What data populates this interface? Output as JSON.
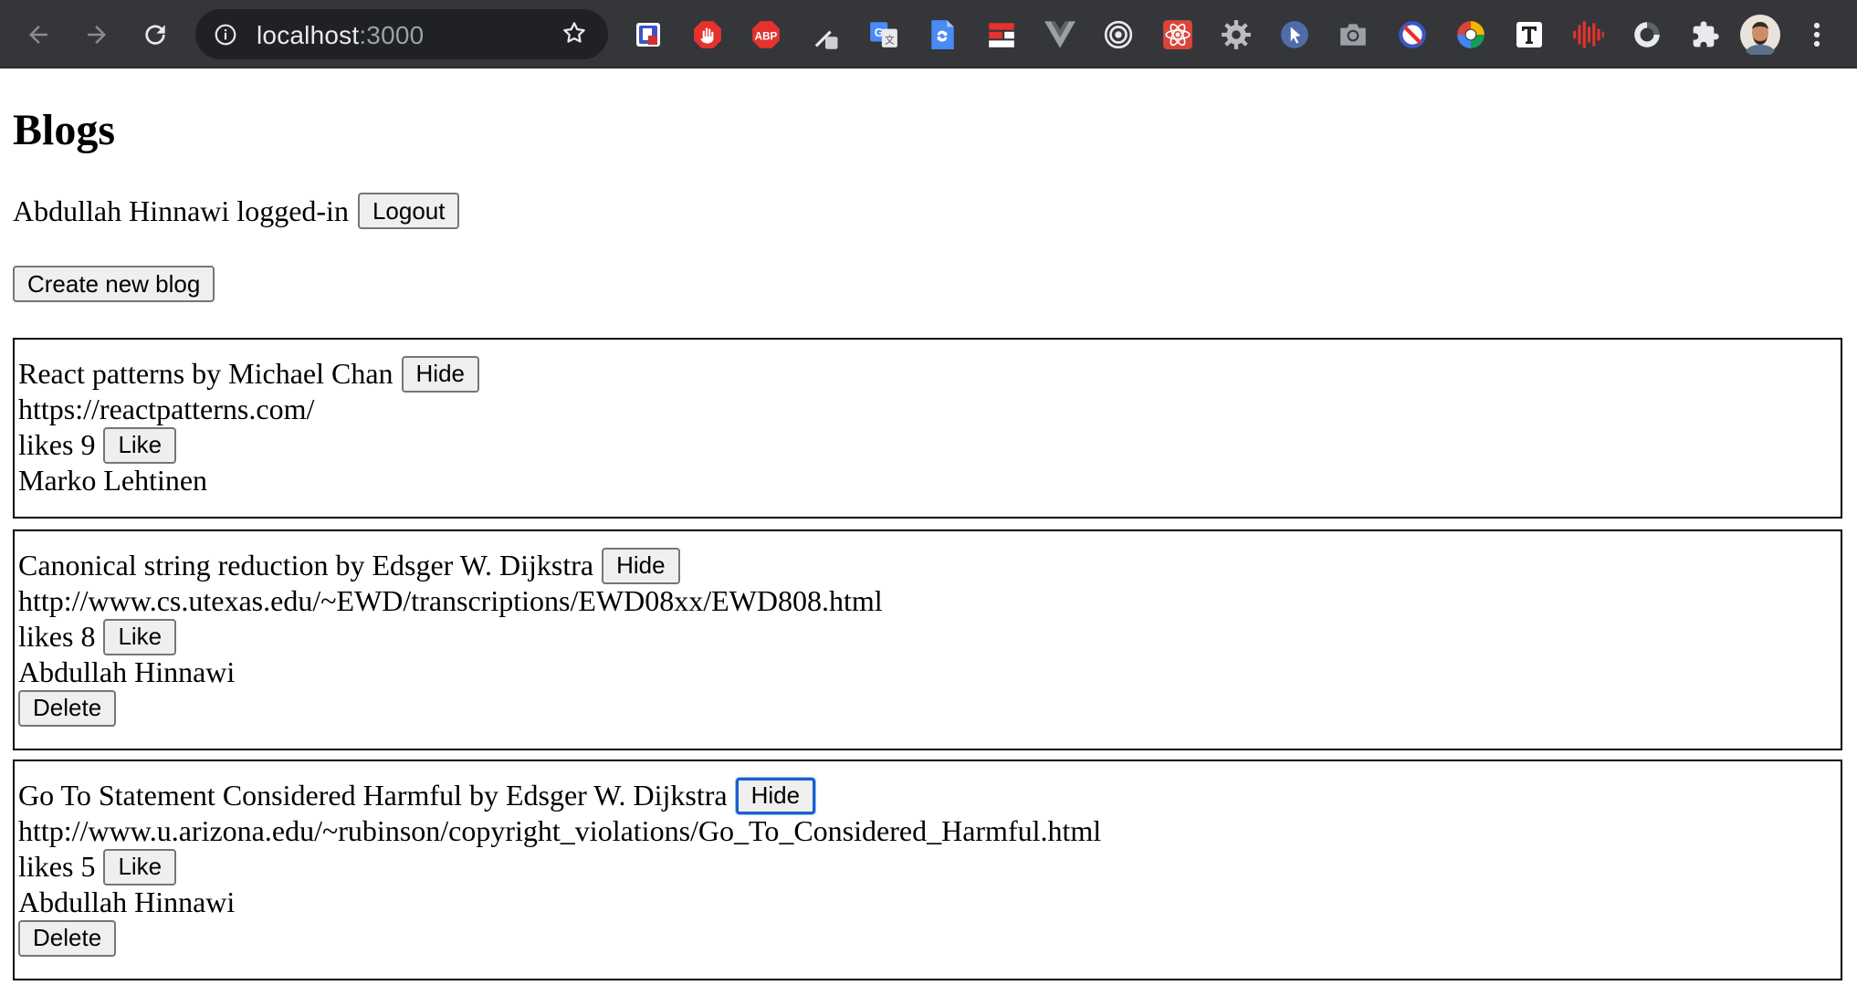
{
  "browser": {
    "url_host": "localhost",
    "url_port": ":3000",
    "extensions": [
      "shield-extension-icon",
      "stop-hand-icon",
      "adblock-plus-icon",
      "eyedropper-icon",
      "google-translate-icon",
      "doc-sync-icon",
      "flag-icon",
      "vue-devtools-icon",
      "target-icon",
      "react-devtools-icon",
      "gear-icon",
      "cursor-icon",
      "camera-icon",
      "no-entry-icon",
      "color-wheel-icon",
      "t-letter-icon",
      "audio-wave-icon",
      "half-circle-icon",
      "puzzle-icon",
      "profile-avatar-icon",
      "kebab-menu-icon"
    ]
  },
  "page": {
    "title": "Blogs",
    "user_name": "Abdullah Hinnawi",
    "logged_in_suffix": "logged-in",
    "logout_label": "Logout",
    "create_label": "Create new blog",
    "hide_label": "Hide",
    "like_label": "Like",
    "delete_label": "Delete",
    "likes_prefix": "likes"
  },
  "blogs": [
    {
      "title_line": "React patterns by Michael Chan",
      "url": "https://reactpatterns.com/",
      "likes": "9",
      "user": "Marko Lehtinen",
      "deletable": false
    },
    {
      "title_line": "Canonical string reduction by Edsger W. Dijkstra",
      "url": "http://www.cs.utexas.edu/~EWD/transcriptions/EWD08xx/EWD808.html",
      "likes": "8",
      "user": "Abdullah Hinnawi",
      "deletable": true
    },
    {
      "title_line": "Go To Statement Considered Harmful by Edsger W. Dijkstra",
      "url": "http://www.u.arizona.edu/~rubinson/copyright_violations/Go_To_Considered_Harmful.html",
      "likes": "5",
      "user": "Abdullah Hinnawi",
      "deletable": true
    }
  ]
}
